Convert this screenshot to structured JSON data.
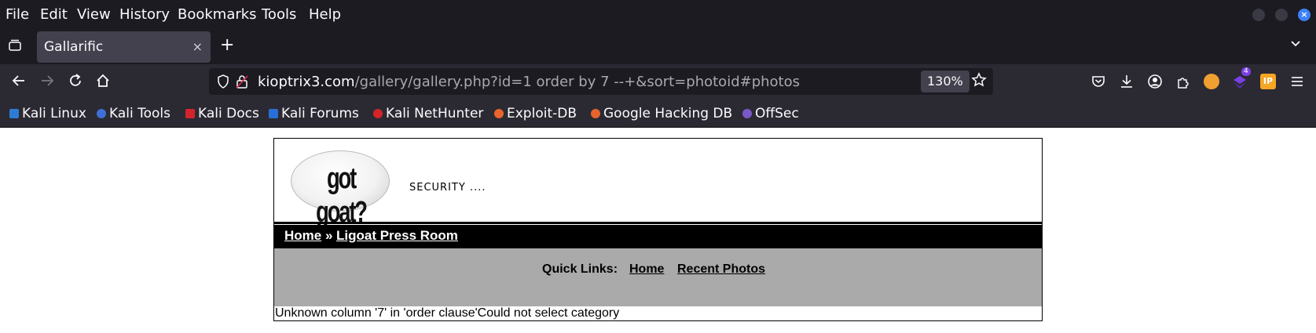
{
  "menubar": {
    "items": [
      "File",
      "Edit",
      "View",
      "History",
      "Bookmarks",
      "Tools",
      "Help"
    ]
  },
  "tab": {
    "title": "Gallarific",
    "close": "×"
  },
  "newtab": "+",
  "url": {
    "host": "kioptrix3.com",
    "path": "/gallery/gallery.php?id=1 order by 7 --+&sort=photoid#photos",
    "zoom": "130%"
  },
  "extension_badge": "4",
  "bookmarks": [
    {
      "label": "Kali Linux",
      "color": "#2e7bd6"
    },
    {
      "label": "Kali Tools",
      "color": "#3f6fd8"
    },
    {
      "label": "Kali Docs",
      "color": "#d3242c"
    },
    {
      "label": "Kali Forums",
      "color": "#2a6fd8"
    },
    {
      "label": "Kali NetHunter",
      "color": "#d3242c"
    },
    {
      "label": "Exploit-DB",
      "color": "#e8642c"
    },
    {
      "label": "Google Hacking DB",
      "color": "#e8642c"
    },
    {
      "label": "OffSec",
      "color": "#7b58c9"
    }
  ],
  "site": {
    "logo_text": "got goat?",
    "tagline": "SECURITY ....",
    "breadcrumb_home": "Home",
    "breadcrumb_sep": "»",
    "breadcrumb_current": "Ligoat Press Room",
    "quicklinks_label": "Quick Links:",
    "quicklinks_home": "Home",
    "quicklinks_recent": "Recent Photos",
    "error": "Unknown column '7' in 'order clause'Could not select category"
  }
}
